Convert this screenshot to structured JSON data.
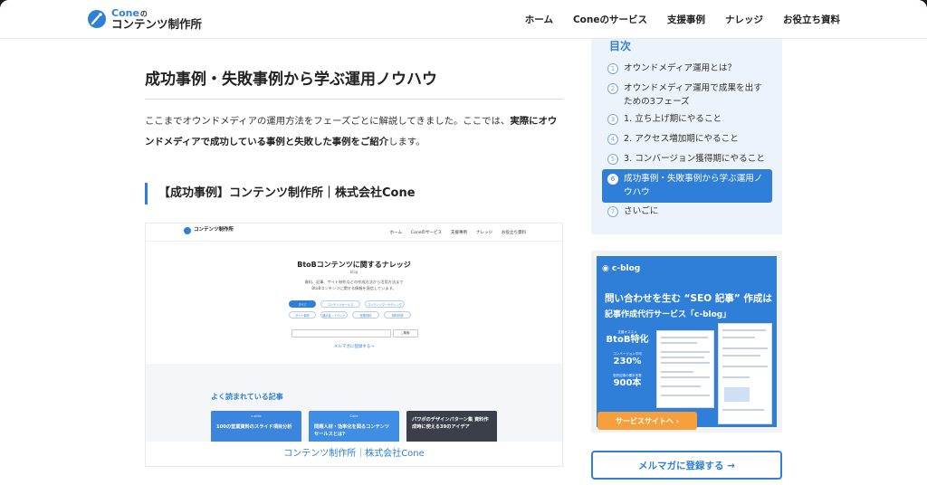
{
  "header": {
    "logo_top": "Cone",
    "logo_top_small": "の",
    "logo_bottom": "コンテンツ制作所",
    "nav": [
      "ホーム",
      "Coneのサービス",
      "支援事例",
      "ナレッジ",
      "お役立ち資料"
    ]
  },
  "article": {
    "h2": "成功事例・失敗事例から学ぶ運用ノウハウ",
    "para_1": "ここまでオウンドメディアの運用方法をフェーズごとに解説してきました。ここでは、",
    "para_bold": "実際にオウンドメディアで成功している事例と失敗した事例をご紹介",
    "para_2": "します。",
    "h3": "【成功事例】コンテンツ制作所｜株式会社Cone",
    "caption": "コンテンツ制作所｜株式会社Cone"
  },
  "embedded": {
    "logo": "コンテンツ制作所",
    "nav": [
      "ホーム",
      "Coneのサービス",
      "支援事例",
      "ナレッジ",
      "お役立ち資料"
    ],
    "title": "BtoBコンテンツに関するナレッジ",
    "sub": "blog",
    "desc_1": "資料、記事、サイト制作などの作成方法から活用方法まで",
    "desc_2": "BtoBコンテンツに関する情報を発信しています。",
    "chips": [
      "すべて",
      "コンテンツセールス",
      "コンテンツマーケティング",
      "サイト制作",
      "展示会・イベント",
      "営業資料",
      "資料作成"
    ],
    "search_btn": "検索",
    "mail": "メルマガに登録する→",
    "popular": "よく読まれている記事",
    "cards": [
      {
        "label": "c-slide",
        "text": "100の営業資料のスライド項目分析"
      },
      {
        "label": "Cone",
        "text": "問題人材・効率化を図るコンテンツセールスとは?"
      },
      {
        "label": "",
        "text": "パワポのデザインパターン集 資料作成時に使える39のアイデア"
      }
    ]
  },
  "toc": {
    "title": "目次",
    "items": [
      {
        "num": "1",
        "label": "オウンドメディア運用とは？"
      },
      {
        "num": "2",
        "label": "オウンドメディア運用で成果を出すための3フェーズ"
      },
      {
        "num": "3",
        "label": "1. 立ち上げ期にやること"
      },
      {
        "num": "4",
        "label": "2. アクセス増加期にやること"
      },
      {
        "num": "5",
        "label": "3. コンバージョン獲得期にやること"
      },
      {
        "num": "6",
        "label": "成功事例・失敗事例から学ぶ運用ノウハウ"
      },
      {
        "num": "7",
        "label": "さいごに"
      }
    ]
  },
  "banner": {
    "logo": "c-blog",
    "head1": "問い合わせを生む “SEO 記事” 作成は",
    "head2": "記事作成代行サービス「c-blog」",
    "stats": [
      {
        "top": "支援オススメ",
        "value": "BtoB特化"
      },
      {
        "top": "コンバージョン平均",
        "value": "230%"
      },
      {
        "top": "制作記事の累計本数",
        "value": "900本"
      }
    ],
    "button": "サービスサイトへ"
  },
  "mail_button": "メルマガに登録する →",
  "colors": {
    "accent": "#2f7fd8",
    "toc_bg": "#edf3fa",
    "cta_orange": "#f5a03c"
  }
}
